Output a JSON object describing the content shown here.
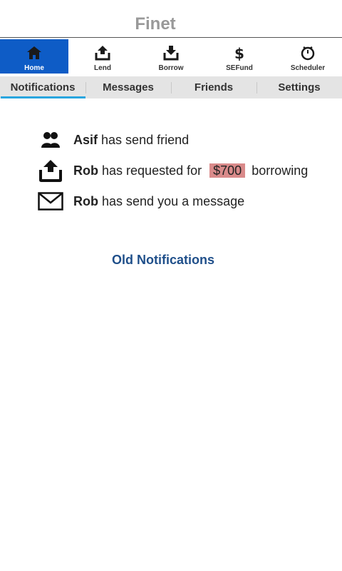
{
  "app": {
    "title": "Finet"
  },
  "toolbar": {
    "items": [
      {
        "label": "Home",
        "icon": "home-icon",
        "active": true
      },
      {
        "label": "Lend",
        "icon": "upload-tray-icon"
      },
      {
        "label": "Borrow",
        "icon": "download-tray-icon"
      },
      {
        "label": "SEFund",
        "icon": "dollar-icon"
      },
      {
        "label": "Scheduler",
        "icon": "stopwatch-icon"
      }
    ],
    "active_color": "#0e5cc6"
  },
  "tabs": {
    "items": [
      {
        "label": "Notifications",
        "active": true
      },
      {
        "label": "Messages"
      },
      {
        "label": "Friends"
      },
      {
        "label": "Settings"
      }
    ],
    "indicator_color": "#2aa6df"
  },
  "notifications": [
    {
      "icon": "friends-icon",
      "name": "Asif",
      "text": "has send friend"
    },
    {
      "icon": "upload-tray-icon",
      "name": "Rob",
      "text_before": "has requested for",
      "amount": "$700",
      "text_after": "borrowing",
      "amount_color": "#d98a8a"
    },
    {
      "icon": "envelope-icon",
      "name": "Rob",
      "text": "has send you a message"
    }
  ],
  "old_notifications": {
    "label": "Old Notifications",
    "color": "#1f4f8a"
  }
}
